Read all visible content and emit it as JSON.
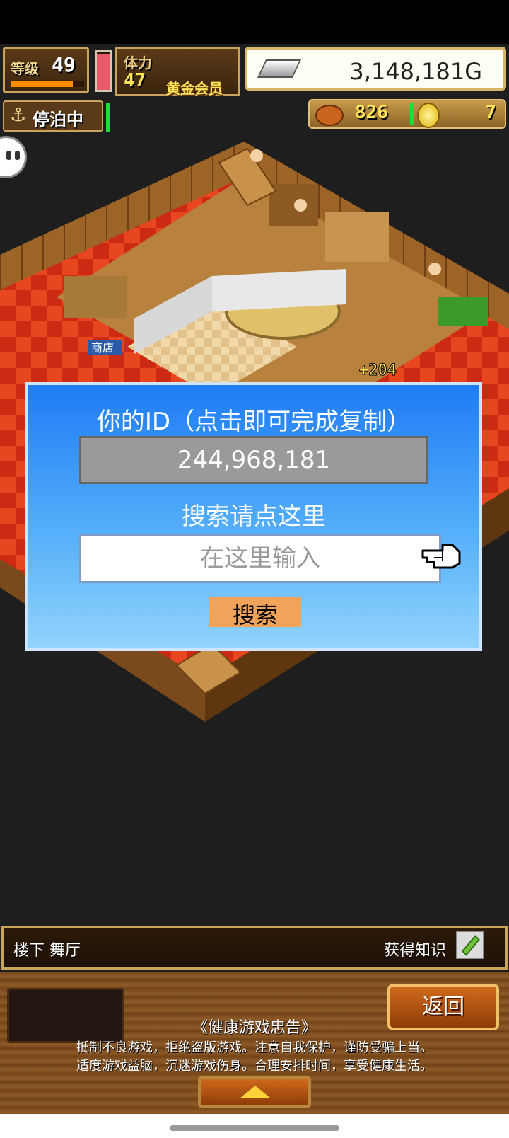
{
  "hud": {
    "level_label": "等级",
    "level_value": "49",
    "level_progress": 0.85,
    "stamina_label": "体力",
    "stamina_value": "47",
    "stamina_fill": 0.95,
    "member_label": "黄金会员",
    "gold_value": "3,148,181G",
    "dock_label": "停泊中",
    "food_value": "826",
    "coin_value": "7"
  },
  "world": {
    "shop_sign": "商店",
    "floating_text": "+204"
  },
  "dialog": {
    "title": "你的ID（点击即可完成复制）",
    "user_id": "244,968,181",
    "search_hint": "搜索请点这里",
    "search_placeholder": "在这里输入",
    "search_value": "",
    "search_button": "搜索"
  },
  "info_bar": {
    "location": "楼下 舞厅",
    "knowledge_label": "获得知识"
  },
  "bottom": {
    "back_button": "返回",
    "health_title": "《健康游戏忠告》",
    "health_line1": "抵制不良游戏，拒绝盗版游戏。注意自我保护，谨防受骗上当。",
    "health_line2": "适度游戏益脑，沉迷游戏伤身。合理安排时间，享受健康生活。"
  },
  "colors": {
    "dialog_top": "#1f7cf4",
    "dialog_bottom": "#92d4fc",
    "search_button": "#f2a35a",
    "floor_red": "#cc2a12",
    "wood": "#a06a2c",
    "status_green": "#19e038"
  },
  "icons": {
    "anchor": "anchor-icon",
    "silver": "silver-ingot-icon",
    "food": "food-icon",
    "coin": "coin-icon",
    "pointer": "hand-pointer-icon",
    "knowledge": "scroll-icon",
    "expand": "up-arrow-icon"
  }
}
